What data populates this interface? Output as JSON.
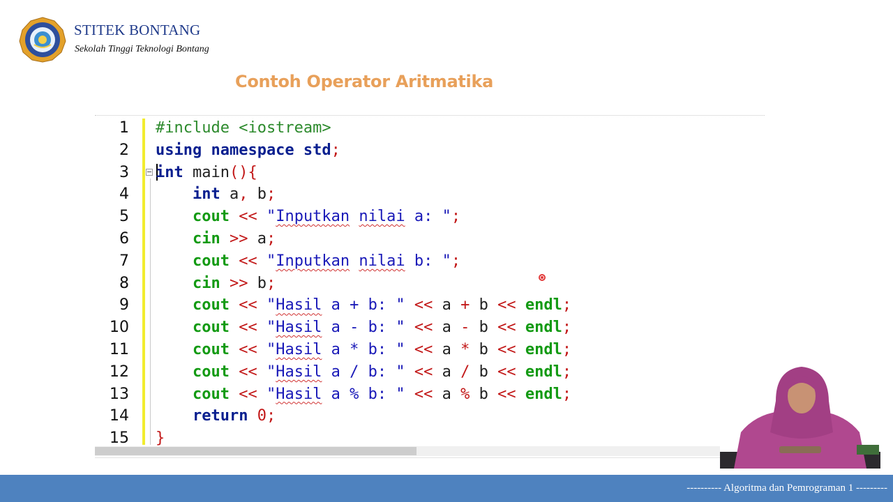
{
  "header": {
    "institution_name": "STITEK BONTANG",
    "institution_subtitle": "Sekolah Tinggi Teknologi Bontang",
    "logo_icon": "campus-emblem-icon"
  },
  "slide": {
    "title": "Contoh Operator Aritmatika"
  },
  "colors": {
    "title_accent": "#e8a05a",
    "gutter_marker": "#f2ec2e",
    "footer_bar": "#4e82bf"
  },
  "editor": {
    "lines": [
      {
        "num": "1",
        "tokens": [
          {
            "t": "#include <iostream>",
            "c": "pre"
          }
        ]
      },
      {
        "num": "2",
        "tokens": [
          {
            "t": "using namespace std",
            "c": "kw"
          },
          {
            "t": ";",
            "c": "op"
          }
        ]
      },
      {
        "num": "3",
        "tokens": [
          {
            "t": "int",
            "c": "kw"
          },
          {
            "t": " main",
            "c": "id"
          },
          {
            "t": "(){",
            "c": "op"
          }
        ]
      },
      {
        "num": "4",
        "tokens": [
          {
            "t": "    ",
            "c": "id"
          },
          {
            "t": "int",
            "c": "kw"
          },
          {
            "t": " a",
            "c": "id"
          },
          {
            "t": ",",
            "c": "op"
          },
          {
            "t": " b",
            "c": "id"
          },
          {
            "t": ";",
            "c": "op"
          }
        ]
      },
      {
        "num": "5",
        "tokens": [
          {
            "t": "    ",
            "c": "id"
          },
          {
            "t": "cout",
            "c": "fn"
          },
          {
            "t": " << ",
            "c": "op"
          },
          {
            "t": "\"",
            "c": "str"
          },
          {
            "t": "Inputkan",
            "c": "str",
            "w": true
          },
          {
            "t": " ",
            "c": "str"
          },
          {
            "t": "nilai",
            "c": "str",
            "w": true
          },
          {
            "t": " a: \"",
            "c": "str"
          },
          {
            "t": ";",
            "c": "op"
          }
        ]
      },
      {
        "num": "6",
        "tokens": [
          {
            "t": "    ",
            "c": "id"
          },
          {
            "t": "cin",
            "c": "fn"
          },
          {
            "t": " >> ",
            "c": "op"
          },
          {
            "t": "a",
            "c": "id"
          },
          {
            "t": ";",
            "c": "op"
          }
        ]
      },
      {
        "num": "7",
        "tokens": [
          {
            "t": "    ",
            "c": "id"
          },
          {
            "t": "cout",
            "c": "fn"
          },
          {
            "t": " << ",
            "c": "op"
          },
          {
            "t": "\"",
            "c": "str"
          },
          {
            "t": "Inputkan",
            "c": "str",
            "w": true
          },
          {
            "t": " ",
            "c": "str"
          },
          {
            "t": "nilai",
            "c": "str",
            "w": true
          },
          {
            "t": " b: \"",
            "c": "str"
          },
          {
            "t": ";",
            "c": "op"
          }
        ]
      },
      {
        "num": "8",
        "tokens": [
          {
            "t": "    ",
            "c": "id"
          },
          {
            "t": "cin",
            "c": "fn"
          },
          {
            "t": " >> ",
            "c": "op"
          },
          {
            "t": "b",
            "c": "id"
          },
          {
            "t": ";",
            "c": "op"
          }
        ]
      },
      {
        "num": "9",
        "tokens": [
          {
            "t": "    ",
            "c": "id"
          },
          {
            "t": "cout",
            "c": "fn"
          },
          {
            "t": " << ",
            "c": "op"
          },
          {
            "t": "\"",
            "c": "str"
          },
          {
            "t": "Hasil",
            "c": "str",
            "w": true
          },
          {
            "t": " a + b: \"",
            "c": "str"
          },
          {
            "t": " << ",
            "c": "op"
          },
          {
            "t": "a",
            "c": "id"
          },
          {
            "t": " + ",
            "c": "op"
          },
          {
            "t": "b",
            "c": "id"
          },
          {
            "t": " << ",
            "c": "op"
          },
          {
            "t": "endl",
            "c": "fn"
          },
          {
            "t": ";",
            "c": "op"
          }
        ]
      },
      {
        "num": "10",
        "tokens": [
          {
            "t": "    ",
            "c": "id"
          },
          {
            "t": "cout",
            "c": "fn"
          },
          {
            "t": " << ",
            "c": "op"
          },
          {
            "t": "\"",
            "c": "str"
          },
          {
            "t": "Hasil",
            "c": "str",
            "w": true
          },
          {
            "t": " a - b: \"",
            "c": "str"
          },
          {
            "t": " << ",
            "c": "op"
          },
          {
            "t": "a",
            "c": "id"
          },
          {
            "t": " - ",
            "c": "op"
          },
          {
            "t": "b",
            "c": "id"
          },
          {
            "t": " << ",
            "c": "op"
          },
          {
            "t": "endl",
            "c": "fn"
          },
          {
            "t": ";",
            "c": "op"
          }
        ]
      },
      {
        "num": "11",
        "tokens": [
          {
            "t": "    ",
            "c": "id"
          },
          {
            "t": "cout",
            "c": "fn"
          },
          {
            "t": " << ",
            "c": "op"
          },
          {
            "t": "\"",
            "c": "str"
          },
          {
            "t": "Hasil",
            "c": "str",
            "w": true
          },
          {
            "t": " a * b: \"",
            "c": "str"
          },
          {
            "t": " << ",
            "c": "op"
          },
          {
            "t": "a",
            "c": "id"
          },
          {
            "t": " * ",
            "c": "op"
          },
          {
            "t": "b",
            "c": "id"
          },
          {
            "t": " << ",
            "c": "op"
          },
          {
            "t": "endl",
            "c": "fn"
          },
          {
            "t": ";",
            "c": "op"
          }
        ]
      },
      {
        "num": "12",
        "tokens": [
          {
            "t": "    ",
            "c": "id"
          },
          {
            "t": "cout",
            "c": "fn"
          },
          {
            "t": " << ",
            "c": "op"
          },
          {
            "t": "\"",
            "c": "str"
          },
          {
            "t": "Hasil",
            "c": "str",
            "w": true
          },
          {
            "t": " a / b: \"",
            "c": "str"
          },
          {
            "t": " << ",
            "c": "op"
          },
          {
            "t": "a",
            "c": "id"
          },
          {
            "t": " / ",
            "c": "op"
          },
          {
            "t": "b",
            "c": "id"
          },
          {
            "t": " << ",
            "c": "op"
          },
          {
            "t": "endl",
            "c": "fn"
          },
          {
            "t": ";",
            "c": "op"
          }
        ]
      },
      {
        "num": "13",
        "tokens": [
          {
            "t": "    ",
            "c": "id"
          },
          {
            "t": "cout",
            "c": "fn"
          },
          {
            "t": " << ",
            "c": "op"
          },
          {
            "t": "\"",
            "c": "str"
          },
          {
            "t": "Hasil",
            "c": "str",
            "w": true
          },
          {
            "t": " a % b: \"",
            "c": "str"
          },
          {
            "t": " << ",
            "c": "op"
          },
          {
            "t": "a",
            "c": "id"
          },
          {
            "t": " % ",
            "c": "op"
          },
          {
            "t": "b",
            "c": "id"
          },
          {
            "t": " << ",
            "c": "op"
          },
          {
            "t": "endl",
            "c": "fn"
          },
          {
            "t": ";",
            "c": "op"
          }
        ]
      },
      {
        "num": "14",
        "tokens": [
          {
            "t": "    ",
            "c": "id"
          },
          {
            "t": "return",
            "c": "kw"
          },
          {
            "t": " ",
            "c": "id"
          },
          {
            "t": "0",
            "c": "num"
          },
          {
            "t": ";",
            "c": "op"
          }
        ]
      },
      {
        "num": "15",
        "tokens": [
          {
            "t": "}",
            "c": "op"
          }
        ]
      }
    ],
    "horizontal_scroll_fraction": 0.48
  },
  "footer": {
    "text": "---------- Algoritma dan Pemrograman 1 ---------"
  }
}
